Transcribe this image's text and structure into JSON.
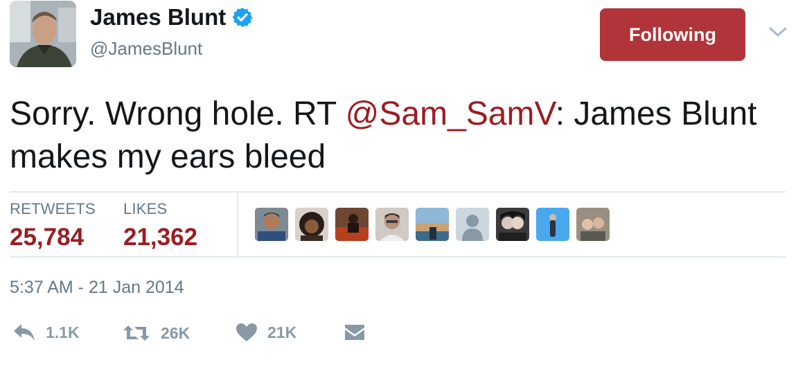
{
  "user": {
    "name": "James Blunt",
    "handle": "@JamesBlunt",
    "verified_icon": "verified-badge-icon",
    "avatar_icon": "profile-photo"
  },
  "header": {
    "follow_label": "Following",
    "follow_color": "#b1343a",
    "menu_icon": "chevron-down-icon"
  },
  "tweet": {
    "text_before": "Sorry. Wrong hole. RT ",
    "mention": "@Sam_SamV",
    "text_after": ": James Blunt makes my ears bleed",
    "mention_color": "#9b1d22"
  },
  "stats": {
    "retweets_label": "RETWEETS",
    "retweets_value": "25,784",
    "likes_label": "LIKES",
    "likes_value": "21,362"
  },
  "likers": [
    {
      "icon": "liker-avatar-1"
    },
    {
      "icon": "liker-avatar-2"
    },
    {
      "icon": "liker-avatar-3"
    },
    {
      "icon": "liker-avatar-4"
    },
    {
      "icon": "liker-avatar-5"
    },
    {
      "icon": "default-avatar-icon"
    },
    {
      "icon": "liker-avatar-7"
    },
    {
      "icon": "liker-avatar-8"
    },
    {
      "icon": "liker-avatar-9"
    }
  ],
  "timestamp": "5:37 AM - 21 Jan 2014",
  "actions": {
    "reply_count": "1.1K",
    "retweet_count": "26K",
    "like_count": "21K",
    "icons": [
      "reply-icon",
      "retweet-icon",
      "heart-icon",
      "direct-message-icon"
    ]
  }
}
